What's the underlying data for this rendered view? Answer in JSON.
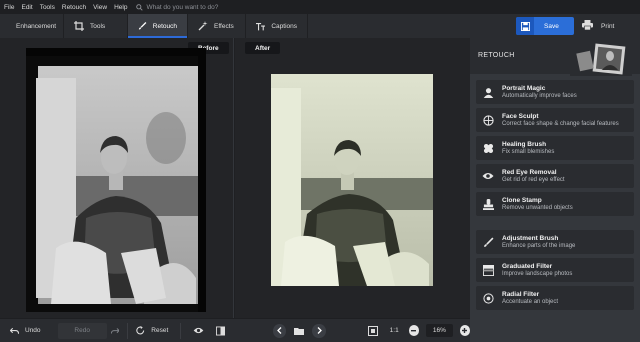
{
  "menu": {
    "items": [
      "File",
      "Edit",
      "Tools",
      "Retouch",
      "View",
      "Help"
    ],
    "search_placeholder": "What do you want to do?"
  },
  "tabs": [
    {
      "label": "Enhancement",
      "icon": "sliders-icon"
    },
    {
      "label": "Tools",
      "icon": "crop-icon"
    },
    {
      "label": "Retouch",
      "icon": "brush-icon",
      "active": true
    },
    {
      "label": "Effects",
      "icon": "magic-wand-icon"
    },
    {
      "label": "Captions",
      "icon": "text-icon"
    }
  ],
  "actions": {
    "save_label": "Save",
    "print_label": "Print"
  },
  "canvas": {
    "before_label": "Before",
    "after_label": "After"
  },
  "bottombar": {
    "undo_label": "Undo",
    "redo_label": "Redo",
    "reset_label": "Reset",
    "ratio_label": "1:1",
    "zoom_value": "16%"
  },
  "panel": {
    "title": "RETOUCH",
    "tools": [
      {
        "name": "Portrait Magic",
        "desc": "Automatically improve faces",
        "icon": "portrait-icon"
      },
      {
        "name": "Face Sculpt",
        "desc": "Correct face shape & change facial features",
        "icon": "face-sculpt-icon"
      },
      {
        "name": "Healing Brush",
        "desc": "Fix small blemishes",
        "icon": "bandage-icon"
      },
      {
        "name": "Red Eye Removal",
        "desc": "Get rid of red eye effect",
        "icon": "eye-icon"
      },
      {
        "name": "Clone Stamp",
        "desc": "Remove unwanted objects",
        "icon": "stamp-icon"
      },
      {
        "name": "Adjustment Brush",
        "desc": "Enhance parts of the image",
        "icon": "brush-icon"
      },
      {
        "name": "Graduated Filter",
        "desc": "Improve landscape photos",
        "icon": "gradient-icon"
      },
      {
        "name": "Radial Filter",
        "desc": "Accentuate an object",
        "icon": "radial-icon"
      }
    ]
  },
  "colors": {
    "accent": "#2b6ed8",
    "panel_bg": "#34373c",
    "canvas_bg": "#232427"
  }
}
